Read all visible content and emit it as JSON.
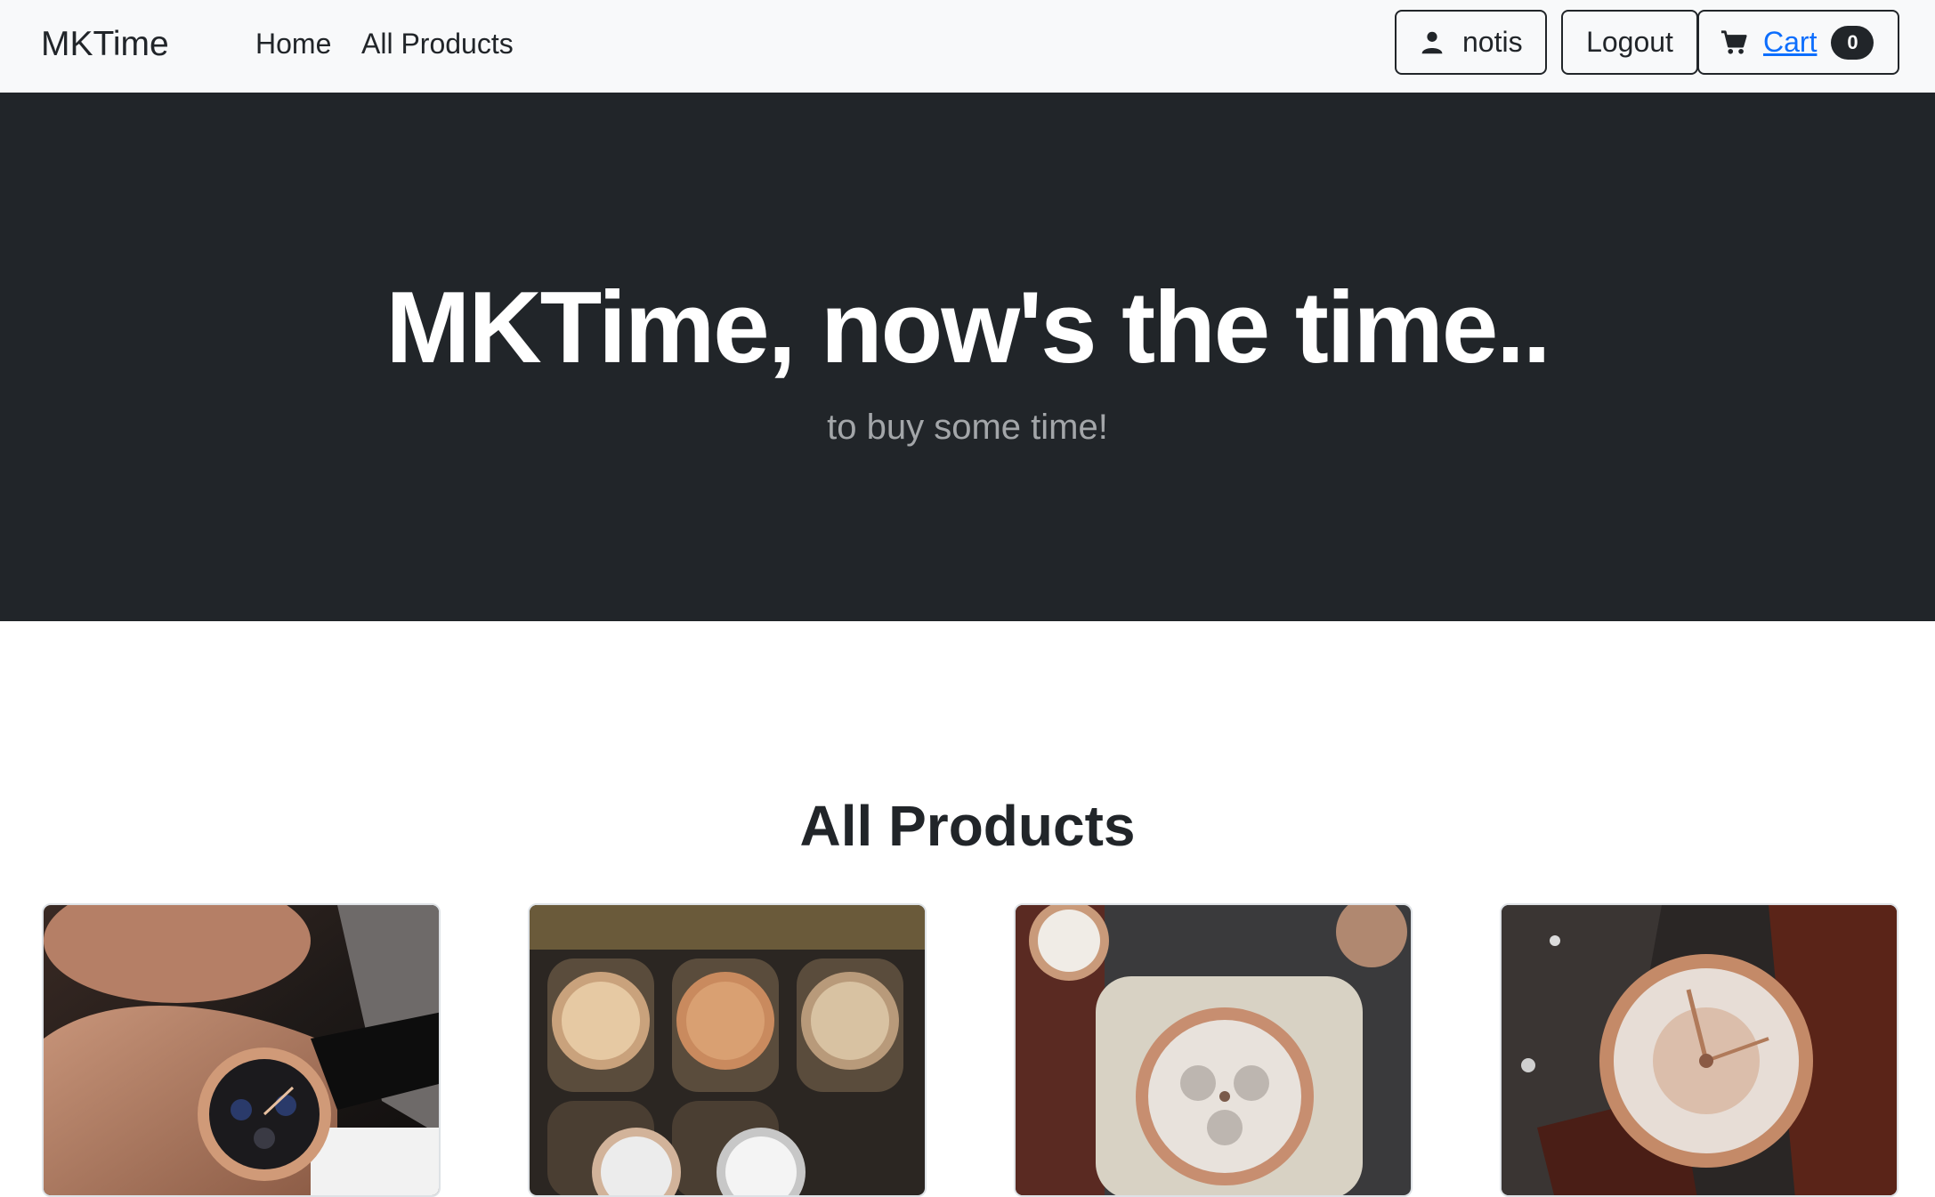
{
  "navbar": {
    "brand": "MKTime",
    "links": [
      {
        "label": "Home"
      },
      {
        "label": "All Products"
      }
    ],
    "user_label": "notis",
    "logout_label": "Logout",
    "cart_label": "Cart",
    "cart_count": "0"
  },
  "hero": {
    "title": "MKTime, now's the time..",
    "subtitle": "to buy some time!"
  },
  "products_section": {
    "title": "All Products"
  },
  "colors": {
    "navbar_bg": "#f8f9fa",
    "hero_bg": "#212529",
    "link_blue": "#0d6efd",
    "rose_gold": "#c98e6e"
  }
}
